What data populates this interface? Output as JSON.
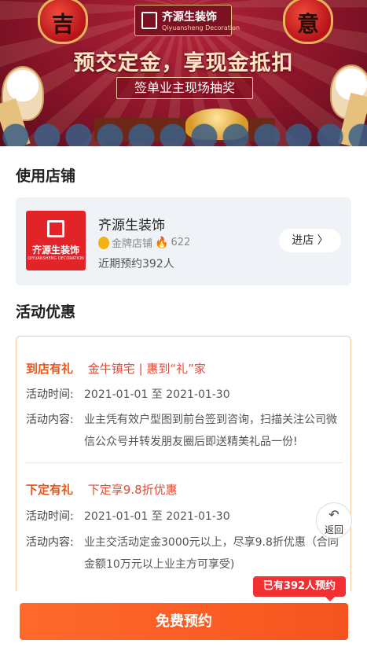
{
  "banner": {
    "lantern_left": "吉",
    "lantern_right": "意",
    "logo_name": "齐源生装饰",
    "logo_tagline": "Qiyuansheng Decoration",
    "headline": "预交定金，享现金抵扣",
    "subline": "签单业主现场抽奖"
  },
  "store_section": {
    "title": "使用店铺",
    "logo_name": "齐源生装饰",
    "logo_sub": "QIYUANSHENG DECORATION",
    "store_name": "齐源生装饰",
    "badge_label": "金牌店铺",
    "popularity": "622",
    "recent_bookings": "近期预约392人",
    "enter_label": "进店 〉"
  },
  "offers_section": {
    "title": "活动优惠",
    "offers": [
      {
        "tag": "到店有礼",
        "headline": "金牛镇宅 | 惠到“礼”家",
        "time_label": "活动时间:",
        "time_value": "2021-01-01 至 2021-01-30",
        "content_label": "活动内容:",
        "content_value": "业主凭有效户型图到前台签到咨询，扫描关注公司微信公众号并转发朋友圈后即送精美礼品一份!"
      },
      {
        "tag": "下定有礼",
        "headline": "下定享9.8折优惠",
        "time_label": "活动时间:",
        "time_value": "2021-01-01 至 2021-01-30",
        "content_label": "活动内容:",
        "content_value": "业主交活动定金3000元以上，尽享9.8折优惠（合同金额10万元以上业主方可享受)"
      }
    ]
  },
  "back_button": {
    "icon": "↶",
    "label": "返回"
  },
  "bottom": {
    "count_badge": "已有392人预约",
    "reserve_label": "免费预约"
  },
  "colors": {
    "accent": "#f5541e",
    "badge": "#f22f33",
    "banner": "#8a1429"
  },
  "icons": [
    "medal-icon",
    "flame-icon",
    "chevron-right-icon",
    "return-arrow-icon"
  ]
}
